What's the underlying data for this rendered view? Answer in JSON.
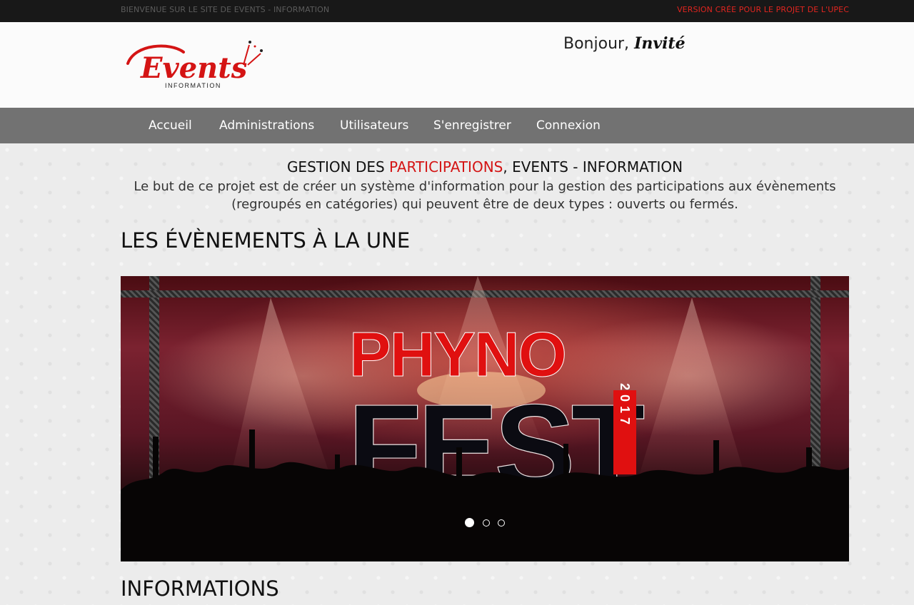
{
  "topbar": {
    "welcome": "BIENVENUE SUR LE SITE DE EVENTS - INFORMATION",
    "version": "VERSION CRÉE POUR LE PROJET DE L'UPEC"
  },
  "header": {
    "logo_text": "Events",
    "logo_subtext": "INFORMATION",
    "greeting": "Bonjour,",
    "user": "Invité"
  },
  "nav": {
    "items": [
      {
        "label": "Accueil"
      },
      {
        "label": "Administrations"
      },
      {
        "label": "Utilisateurs"
      },
      {
        "label": "S'enregistrer"
      },
      {
        "label": "Connexion"
      }
    ]
  },
  "intro": {
    "title_part1": "GESTION DES ",
    "title_accent": "PARTICIPATIONS",
    "title_part2": ", EVENTS - INFORMATION",
    "text": "Le but de ce projet est de créer un système d'information pour la gestion des participations aux évènements (regroupés en catégories) qui peuvent être de deux types : ouverts ou fermés."
  },
  "featured": {
    "title": "LES ÉVÈNEMENTS À LA UNE",
    "slide": {
      "line1": "PHYNO",
      "line2": "FEST",
      "year": "2017"
    },
    "slide_count": 3,
    "active_slide": 1
  },
  "informations": {
    "title": "INFORMATIONS"
  },
  "colors": {
    "accent": "#d41414",
    "topbar": "#181818",
    "nav": "#727272"
  }
}
